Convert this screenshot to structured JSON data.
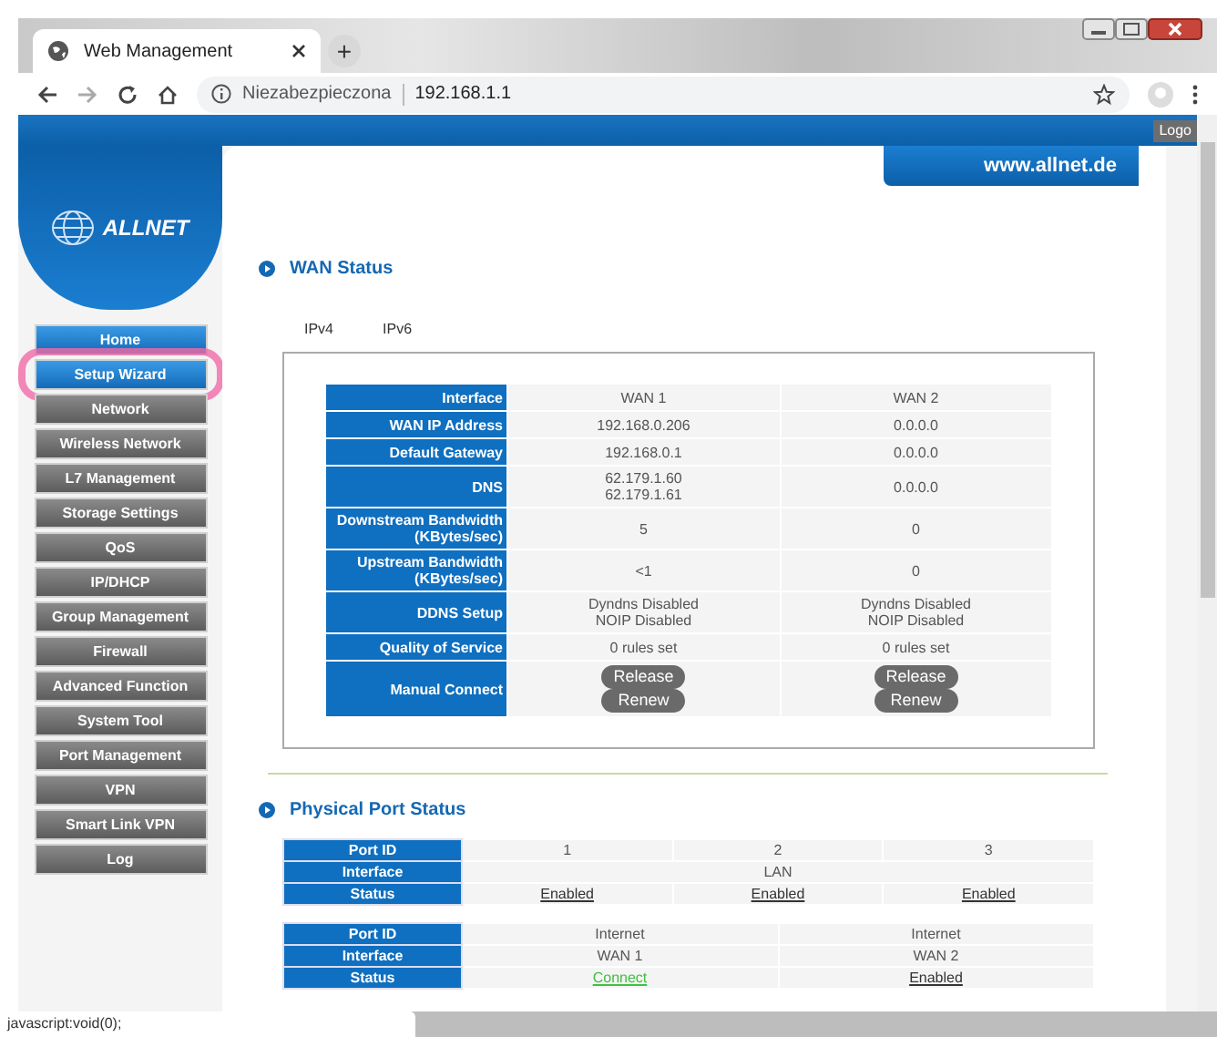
{
  "browser": {
    "tab_title": "Web Management",
    "new_tab": "+",
    "security": "Niezabezpieczona",
    "url": "192.168.1.1",
    "status_text": "javascript:void(0);"
  },
  "header": {
    "site": "www.allnet.de",
    "logout": "Logo",
    "brand": "ALLNET"
  },
  "nav": [
    {
      "label": "Home",
      "active": true,
      "circled": false
    },
    {
      "label": "Setup Wizard",
      "active": true,
      "circled": true
    },
    {
      "label": "Network",
      "active": false,
      "circled": false
    },
    {
      "label": "Wireless Network",
      "active": false,
      "circled": false
    },
    {
      "label": "L7 Management",
      "active": false,
      "circled": false
    },
    {
      "label": "Storage Settings",
      "active": false,
      "circled": false
    },
    {
      "label": "QoS",
      "active": false,
      "circled": false
    },
    {
      "label": "IP/DHCP",
      "active": false,
      "circled": false
    },
    {
      "label": "Group Management",
      "active": false,
      "circled": false
    },
    {
      "label": "Firewall",
      "active": false,
      "circled": false
    },
    {
      "label": "Advanced Function",
      "active": false,
      "circled": false
    },
    {
      "label": "System Tool",
      "active": false,
      "circled": false
    },
    {
      "label": "Port Management",
      "active": false,
      "circled": false
    },
    {
      "label": "VPN",
      "active": false,
      "circled": false
    },
    {
      "label": "Smart Link VPN",
      "active": false,
      "circled": false
    },
    {
      "label": "Log",
      "active": false,
      "circled": false
    }
  ],
  "wan_status": {
    "title": "WAN Status",
    "tabs": [
      "IPv4",
      "IPv6"
    ],
    "rows": [
      {
        "label": "Interface",
        "kind": "text",
        "values": [
          "WAN 1",
          "WAN 2"
        ]
      },
      {
        "label": "WAN IP Address",
        "kind": "text",
        "values": [
          "192.168.0.206",
          "0.0.0.0"
        ]
      },
      {
        "label": "Default Gateway",
        "kind": "text",
        "values": [
          "192.168.0.1",
          "0.0.0.0"
        ]
      },
      {
        "label": "DNS",
        "kind": "text",
        "values": [
          "62.179.1.60\n62.179.1.61",
          "0.0.0.0"
        ]
      },
      {
        "label": "Downstream Bandwidth\n(KBytes/sec)",
        "kind": "text",
        "values": [
          "5",
          "0"
        ]
      },
      {
        "label": "Upstream Bandwidth\n(KBytes/sec)",
        "kind": "text",
        "values": [
          "<1",
          "0"
        ]
      },
      {
        "label": "DDNS Setup",
        "kind": "text",
        "values": [
          "Dyndns Disabled\nNOIP Disabled",
          "Dyndns Disabled\nNOIP Disabled"
        ]
      },
      {
        "label": "Quality of Service",
        "kind": "text",
        "values": [
          "0 rules set",
          "0 rules set"
        ]
      },
      {
        "label": "Manual Connect",
        "kind": "buttons",
        "values": [
          [
            "Release",
            "Renew"
          ],
          [
            "Release",
            "Renew"
          ]
        ]
      }
    ]
  },
  "port_status": {
    "title": "Physical Port Status",
    "tables": [
      {
        "port_id_label": "Port ID",
        "port_ids": [
          "1",
          "2",
          "3"
        ],
        "interface_label": "Interface",
        "interface": "LAN",
        "status_label": "Status",
        "statuses": [
          {
            "text": "Enabled",
            "kind": "enabled"
          },
          {
            "text": "Enabled",
            "kind": "enabled"
          },
          {
            "text": "Enabled",
            "kind": "enabled"
          }
        ]
      },
      {
        "port_id_label": "Port ID",
        "port_ids": [
          "Internet",
          "Internet"
        ],
        "interface_label": "Interface",
        "interfaces": [
          "WAN 1",
          "WAN 2"
        ],
        "status_label": "Status",
        "statuses": [
          {
            "text": "Connect",
            "kind": "connected"
          },
          {
            "text": "Enabled",
            "kind": "enabled"
          }
        ]
      }
    ]
  }
}
